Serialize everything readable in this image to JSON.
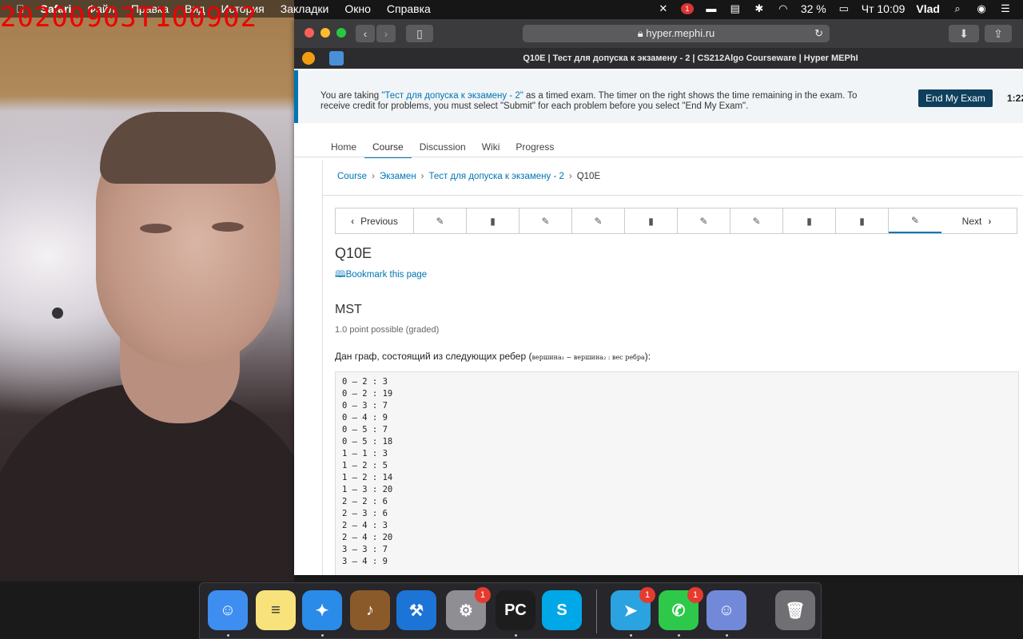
{
  "overlay": {
    "timestamp": "20200903T100902"
  },
  "menubar": {
    "apple": "",
    "items": [
      "Safari",
      "Файл",
      "Правка",
      "Вид",
      "История",
      "Закладки",
      "Окно",
      "Справка"
    ],
    "battery": "32 %",
    "clock": "Чт 10:09",
    "user": "Vlad",
    "notif_badge": "1"
  },
  "browser": {
    "url": "hyper.mephi.ru",
    "tab_title": "Q10E | Тест для допуска к экзамену - 2 | CS212Algo Courseware | Hyper MEPhI"
  },
  "notice": {
    "prefix": "You are taking ",
    "exam_link": "\"Тест для допуска к экзамену - 2\"",
    "suffix": " as a timed exam. The timer on the right shows the time remaining in the exam. To receive credit for problems, you must select \"Submit\" for each problem before you select \"End My Exam\".",
    "end_button": "End My Exam",
    "timer": "1:22:"
  },
  "course_nav": {
    "tabs": [
      "Home",
      "Course",
      "Discussion",
      "Wiki",
      "Progress"
    ],
    "active": "Course"
  },
  "breadcrumb": {
    "items": [
      "Course",
      "Экзамен",
      "Тест для допуска к экзамену - 2"
    ],
    "current": "Q10E"
  },
  "sequence": {
    "previous": "Previous",
    "next": "Next",
    "units": [
      "problem",
      "video",
      "problem",
      "problem",
      "video",
      "problem",
      "problem",
      "video",
      "video",
      "problem"
    ],
    "active_index": 9
  },
  "unit": {
    "title": "Q10E",
    "bookmark": "Bookmark this page"
  },
  "problem": {
    "title": "MST",
    "points": "1.0 point possible (graded)",
    "text": "Дан граф, состоящий из следующих ребер (",
    "math": "вершина₁ − вершина₂ : вес ребра",
    "text_end": "):",
    "edges": [
      "0 – 2 : 3",
      "0 – 2 : 19",
      "0 – 3 : 7",
      "0 – 4 : 9",
      "0 – 5 : 7",
      "0 – 5 : 18",
      "1 – 1 : 3",
      "1 – 2 : 5",
      "1 – 2 : 14",
      "1 – 3 : 20",
      "2 – 2 : 6",
      "2 – 3 : 6",
      "2 – 4 : 3",
      "2 – 4 : 20",
      "3 – 3 : 7",
      "3 – 4 : 9"
    ]
  },
  "dock": {
    "apps": [
      {
        "name": "Finder",
        "color": "#3d8ef0",
        "glyph": "☺"
      },
      {
        "name": "Notes",
        "color": "#f7e27b",
        "glyph": "≡"
      },
      {
        "name": "Safari",
        "color": "#2a8be8",
        "glyph": "✦"
      },
      {
        "name": "GarageBand",
        "color": "#8a5a2b",
        "glyph": "♪"
      },
      {
        "name": "Xcode",
        "color": "#1c74d6",
        "glyph": "⚒"
      },
      {
        "name": "System Preferences",
        "color": "#8e8e93",
        "glyph": "⚙"
      },
      {
        "name": "PyCharm",
        "color": "#1d1d1d",
        "glyph": "PC"
      },
      {
        "name": "Skype",
        "color": "#00a8e8",
        "glyph": "S"
      },
      {
        "name": "Telegram",
        "color": "#2aa3e0",
        "glyph": "➤"
      },
      {
        "name": "FaceTime",
        "color": "#2ec94a",
        "glyph": "✆"
      },
      {
        "name": "Discord",
        "color": "#7289da",
        "glyph": "☺"
      },
      {
        "name": "Trash",
        "color": "#6f6f74",
        "glyph": "🗑"
      }
    ],
    "badges": {
      "System Preferences": "1",
      "Telegram": "1",
      "FaceTime": "1"
    }
  }
}
